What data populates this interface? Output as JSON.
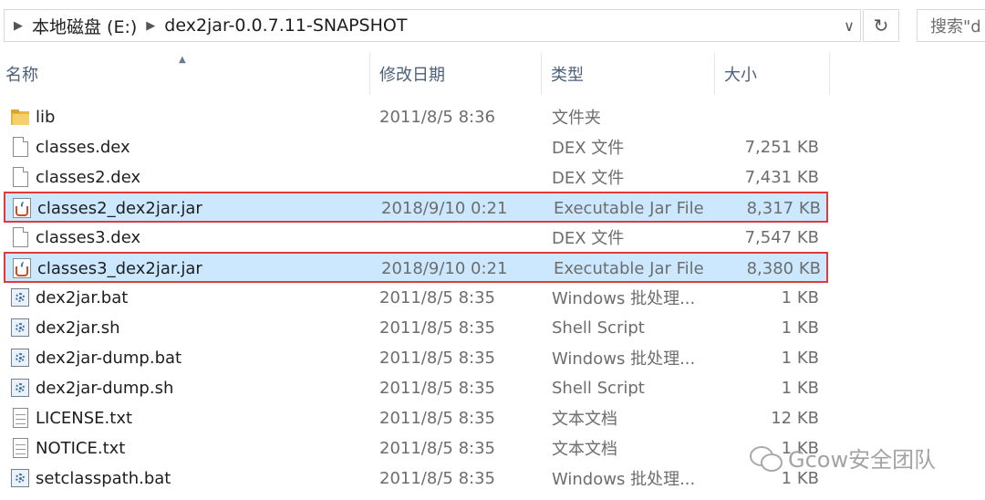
{
  "address_bar": {
    "crumbs": [
      "本地磁盘 (E:)",
      "dex2jar-0.0.7.11-SNAPSHOT"
    ],
    "search_placeholder": "搜索\"d"
  },
  "columns": {
    "name": "名称",
    "date": "修改日期",
    "type": "类型",
    "size": "大小"
  },
  "files": [
    {
      "name": "lib",
      "date": "2011/8/5 8:36",
      "type": "文件夹",
      "size": "",
      "icon": "folder-icon",
      "selected": false
    },
    {
      "name": "classes.dex",
      "date": "",
      "type": "DEX 文件",
      "size": "7,251 KB",
      "icon": "file-icon",
      "selected": false
    },
    {
      "name": "classes2.dex",
      "date": "",
      "type": "DEX 文件",
      "size": "7,431 KB",
      "icon": "file-icon",
      "selected": false
    },
    {
      "name": "classes2_dex2jar.jar",
      "date": "2018/9/10 0:21",
      "type": "Executable Jar File",
      "size": "8,317 KB",
      "icon": "jar-icon",
      "selected": true
    },
    {
      "name": "classes3.dex",
      "date": "",
      "type": "DEX 文件",
      "size": "7,547 KB",
      "icon": "file-icon",
      "selected": false
    },
    {
      "name": "classes3_dex2jar.jar",
      "date": "2018/9/10 0:21",
      "type": "Executable Jar File",
      "size": "8,380 KB",
      "icon": "jar-icon",
      "selected": true
    },
    {
      "name": "dex2jar.bat",
      "date": "2011/8/5 8:35",
      "type": "Windows 批处理...",
      "size": "1 KB",
      "icon": "script-icon",
      "selected": false
    },
    {
      "name": "dex2jar.sh",
      "date": "2011/8/5 8:35",
      "type": "Shell Script",
      "size": "1 KB",
      "icon": "script-icon",
      "selected": false
    },
    {
      "name": "dex2jar-dump.bat",
      "date": "2011/8/5 8:35",
      "type": "Windows 批处理...",
      "size": "1 KB",
      "icon": "script-icon",
      "selected": false
    },
    {
      "name": "dex2jar-dump.sh",
      "date": "2011/8/5 8:35",
      "type": "Shell Script",
      "size": "1 KB",
      "icon": "script-icon",
      "selected": false
    },
    {
      "name": "LICENSE.txt",
      "date": "2011/8/5 8:35",
      "type": "文本文档",
      "size": "12 KB",
      "icon": "text-file-icon",
      "selected": false
    },
    {
      "name": "NOTICE.txt",
      "date": "2011/8/5 8:35",
      "type": "文本文档",
      "size": "1 KB",
      "icon": "text-file-icon",
      "selected": false
    },
    {
      "name": "setclasspath.bat",
      "date": "2011/8/5 8:35",
      "type": "Windows 批处理...",
      "size": "1 KB",
      "icon": "script-icon",
      "selected": false
    }
  ],
  "watermark": "Gcow安全团队",
  "colors": {
    "selection_bg": "#cce8ff",
    "highlight_border": "#e03a3a",
    "header_text": "#4c607a"
  }
}
